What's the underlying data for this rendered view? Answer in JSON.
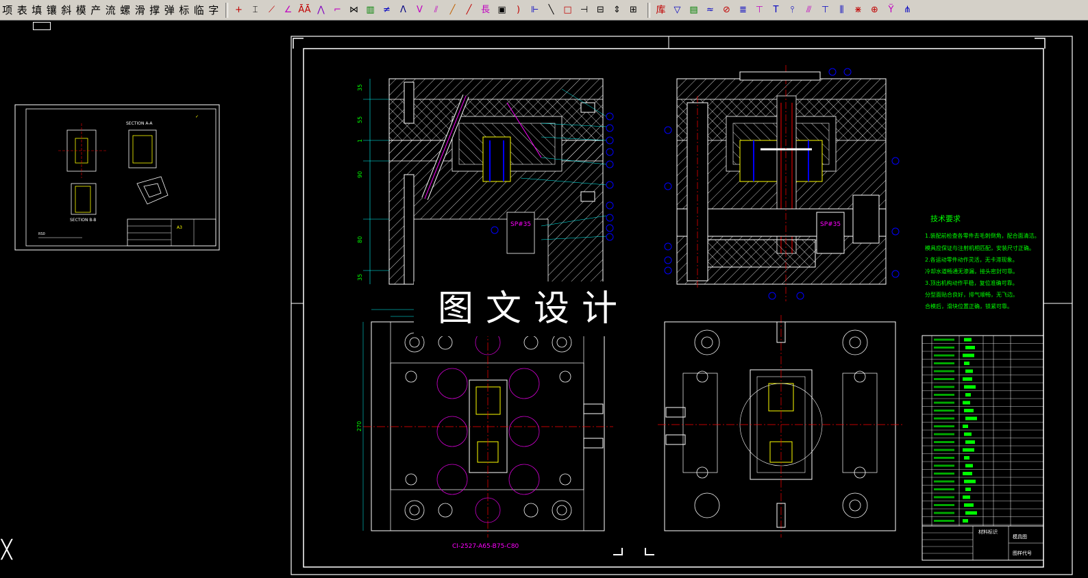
{
  "toolbar": {
    "commands": [
      "项",
      "表",
      "填",
      "镶",
      "斜",
      "模",
      "产",
      "流",
      "螺",
      "滑",
      "撑",
      "弹",
      "标",
      "临",
      "字"
    ],
    "library_label": "库",
    "long_label": "長",
    "tools_group1": [
      {
        "icon": "cross-icon",
        "glyph": "+",
        "color": "#c00000"
      },
      {
        "icon": "dimension-h-icon",
        "glyph": "⌶",
        "color": "#000000"
      },
      {
        "icon": "diag-hatch-icon",
        "glyph": "⟋",
        "color": "#c00000"
      },
      {
        "icon": "angle-icon",
        "glyph": "∠",
        "color": "#c000c0"
      },
      {
        "icon": "aa-text-icon",
        "glyph": "ĀĀ",
        "color": "#c00000"
      },
      {
        "icon": "zigzag-icon",
        "glyph": "⋀",
        "color": "#8000c0"
      },
      {
        "icon": "bend-icon",
        "glyph": "⌐",
        "color": "#c000c0"
      },
      {
        "icon": "twist-icon",
        "glyph": "⋈",
        "color": "#000000"
      },
      {
        "icon": "stripe-icon",
        "glyph": "▥",
        "color": "#008000"
      },
      {
        "icon": "diff-icon",
        "glyph": "≠",
        "color": "#0000c0"
      },
      {
        "icon": "peak-icon",
        "glyph": "Λ",
        "color": "#000080"
      },
      {
        "icon": "valley-icon",
        "glyph": "V",
        "color": "#c000c0"
      },
      {
        "icon": "slash-multi-icon",
        "glyph": "⫽",
        "color": "#c000c0"
      },
      {
        "icon": "slash-icon",
        "glyph": "╱",
        "color": "#c06000"
      },
      {
        "icon": "line-icon",
        "glyph": "╱",
        "color": "#c00000"
      },
      {
        "icon": "long-icon",
        "glyph": "長",
        "color": "#c000c0"
      },
      {
        "icon": "box-pin-icon",
        "glyph": "▣",
        "color": "#000000"
      },
      {
        "icon": "arc-icon",
        "glyph": ")",
        "color": "#c00000"
      },
      {
        "icon": "bracket-icon",
        "glyph": "⊩",
        "color": "#0000c0"
      },
      {
        "icon": "diag-line-icon",
        "glyph": "╲",
        "color": "#000000"
      },
      {
        "icon": "frame-icon",
        "glyph": "□",
        "color": "#c00000"
      },
      {
        "icon": "branch-icon",
        "glyph": "⊣",
        "color": "#000000"
      },
      {
        "icon": "minus-icon",
        "glyph": "⊟",
        "color": "#000000"
      },
      {
        "icon": "vbar-icon",
        "glyph": "⇕",
        "color": "#000000"
      },
      {
        "icon": "corner-icon",
        "glyph": "⊞",
        "color": "#000000"
      }
    ],
    "tools_group2": [
      {
        "icon": "funnel-icon",
        "glyph": "▽",
        "color": "#0000c0"
      },
      {
        "icon": "slot-icon",
        "glyph": "▤",
        "color": "#008000"
      },
      {
        "icon": "wave-icon",
        "glyph": "≈",
        "color": "#0000c0"
      },
      {
        "icon": "no-icon",
        "glyph": "⊘",
        "color": "#c00000"
      },
      {
        "icon": "spring-icon",
        "glyph": "≣",
        "color": "#0000c0"
      },
      {
        "icon": "screw-icon",
        "glyph": "⊤",
        "color": "#c000c0"
      },
      {
        "icon": "tee-icon",
        "glyph": "T",
        "color": "#0000c0"
      },
      {
        "icon": "pin-icon",
        "glyph": "⫯",
        "color": "#0000c0"
      },
      {
        "icon": "slash-lines-icon",
        "glyph": "⫻",
        "color": "#c000c0"
      },
      {
        "icon": "socket-icon",
        "glyph": "⊤",
        "color": "#0000c0"
      },
      {
        "icon": "column-icon",
        "glyph": "⫼",
        "color": "#0000c0"
      },
      {
        "icon": "tangle-icon",
        "glyph": "⋇",
        "color": "#c00000"
      },
      {
        "icon": "target-icon",
        "glyph": "⊕",
        "color": "#c00000"
      },
      {
        "icon": "goblet-icon",
        "glyph": "Ÿ",
        "color": "#c000c0"
      },
      {
        "icon": "fork-icon",
        "glyph": "⋔",
        "color": "#0000c0"
      }
    ]
  },
  "drawing": {
    "watermark": "图文设计",
    "tech_title": "技术要求",
    "tech_lines": [
      "1.装配前检查各零件去毛刺倒角，配合面清洁。",
      "模具应保证与注射机相匹配，安装尺寸正确。",
      "2.各运动零件动作灵活，无卡滞现象。",
      "冷却水道畅通无渗漏，接头密封可靠。",
      "3.顶出机构动作平稳，复位准确可靠。",
      "分型面贴合良好，排气顺畅，无飞边。",
      "合模后，滑块位置正确，锁紧可靠。"
    ],
    "spec_label": "CI-2527-A65-B75-C80",
    "sp_label": "SP#35",
    "section_aa": "SECTION A-A",
    "section_bb": "SECTION B-B",
    "thumb_title": "A3",
    "title_block_name": "材料标识",
    "title_block_part": "模具图",
    "title_block_code": "图样代号",
    "dim_270": "270",
    "dim_left": [
      "35",
      "55",
      "1",
      "90",
      "80",
      "35"
    ]
  }
}
